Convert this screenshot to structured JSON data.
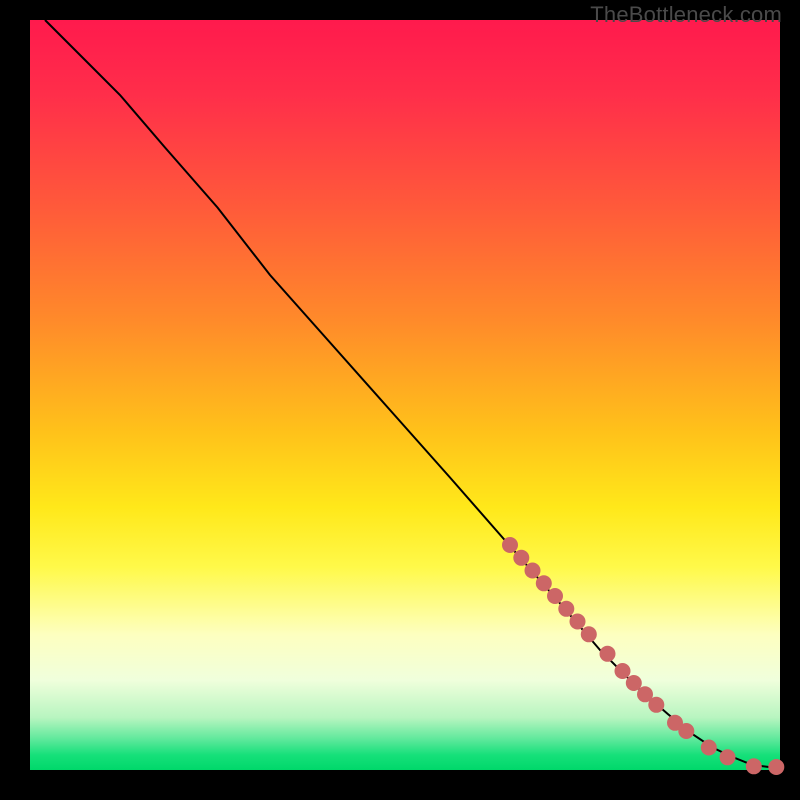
{
  "watermark": "TheBottleneck.com",
  "chart_data": {
    "type": "line",
    "title": "",
    "xlabel": "",
    "ylabel": "",
    "xlim": [
      0,
      100
    ],
    "ylim": [
      0,
      100
    ],
    "grid": false,
    "legend": false,
    "series": [
      {
        "name": "curve",
        "color": "#000000",
        "x": [
          2,
          5,
          8,
          12,
          18,
          25,
          32,
          40,
          48,
          56,
          63,
          70,
          76,
          81,
          85,
          88,
          91,
          93.5,
          95.5,
          97,
          98.5,
          100
        ],
        "y": [
          100,
          97,
          94,
          90,
          83,
          75,
          66,
          57,
          48,
          39,
          31,
          23,
          16,
          11,
          7.5,
          5,
          3,
          1.8,
          1.0,
          0.6,
          0.4,
          0.4
        ]
      }
    ],
    "highlighted_points": {
      "name": "dots",
      "color": "#cc6666",
      "x": [
        64,
        65.5,
        67,
        68.5,
        70,
        71.5,
        73,
        74.5,
        77,
        79,
        80.5,
        82,
        83.5,
        86,
        87.5,
        90.5,
        93,
        96.5,
        99.5
      ],
      "y": [
        30,
        28.3,
        26.6,
        24.9,
        23.2,
        21.5,
        19.8,
        18.1,
        15.5,
        13.2,
        11.6,
        10.1,
        8.7,
        6.3,
        5.2,
        3.0,
        1.7,
        0.5,
        0.4
      ]
    },
    "background_gradient": {
      "direction": "vertical",
      "stops": [
        {
          "pos": 0.0,
          "color": "#ff1a4d"
        },
        {
          "pos": 0.25,
          "color": "#ff5a3a"
        },
        {
          "pos": 0.55,
          "color": "#ffc21a"
        },
        {
          "pos": 0.75,
          "color": "#fff94a"
        },
        {
          "pos": 0.93,
          "color": "#b8f5c0"
        },
        {
          "pos": 1.0,
          "color": "#00d86a"
        }
      ]
    }
  }
}
